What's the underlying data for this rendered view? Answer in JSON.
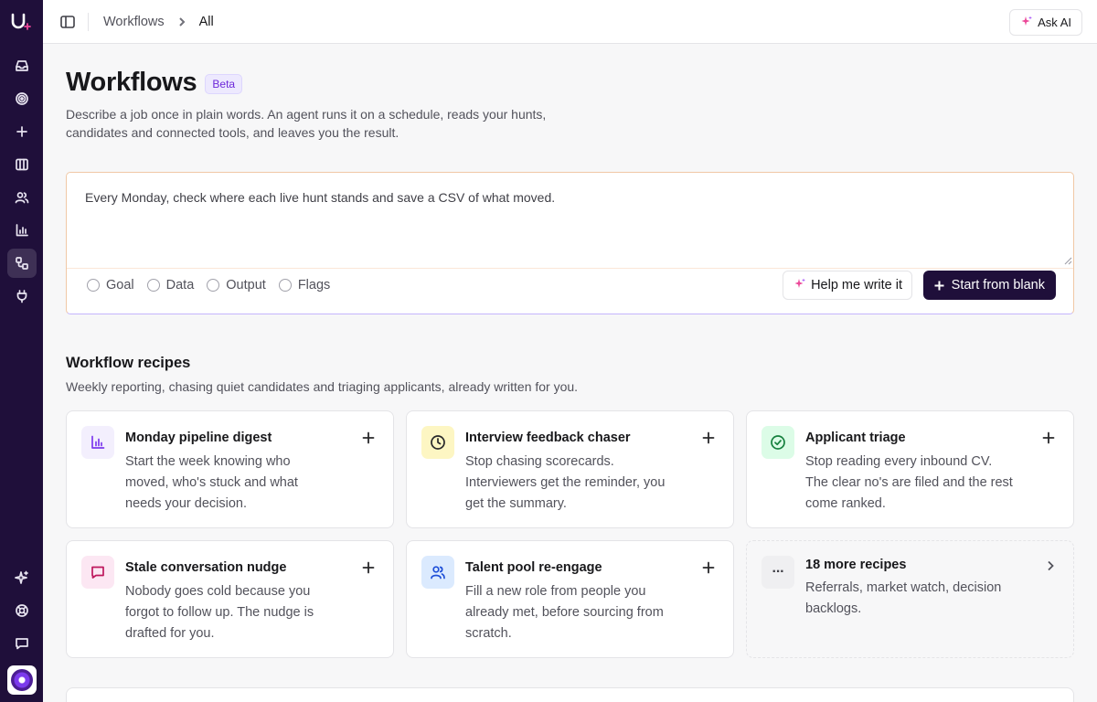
{
  "app": {
    "logo_text": "U"
  },
  "sidebar": {
    "items": [
      {
        "name": "inbox-icon"
      },
      {
        "name": "target-icon"
      },
      {
        "name": "plus-icon"
      },
      {
        "name": "columns-icon"
      },
      {
        "name": "users-icon"
      },
      {
        "name": "chart-icon"
      },
      {
        "name": "workflow-icon",
        "active": true
      },
      {
        "name": "plug-icon"
      }
    ],
    "bottom": [
      {
        "name": "sparkles-icon"
      },
      {
        "name": "help-icon"
      },
      {
        "name": "message-icon"
      }
    ]
  },
  "topbar": {
    "breadcrumb": [
      "Workflows",
      "All"
    ],
    "ask_ai": "Ask AI"
  },
  "header": {
    "title": "Workflows",
    "badge": "Beta",
    "subtitle": "Describe a job once in plain words. An agent runs it on a schedule, reads your hunts, candidates and connected tools, and leaves you the result."
  },
  "composer": {
    "value": "Every Monday, check where each live hunt stands and save a CSV of what moved.",
    "chips": [
      "Goal",
      "Data",
      "Output",
      "Flags"
    ],
    "help_label": "Help me write it",
    "blank_label": "Start from blank"
  },
  "recipes": {
    "title": "Workflow recipes",
    "subtitle": "Weekly reporting, chasing quiet candidates and triaging applicants, already written for you.",
    "cards": [
      {
        "title": "Monday pipeline digest",
        "desc": "Start the week knowing who moved, who's stuck and what needs your decision.",
        "icon": "bar-chart-icon",
        "color": "#7c3aed",
        "bg": "#f3effd"
      },
      {
        "title": "Interview feedback chaser",
        "desc": "Stop chasing scorecards. Interviewers get the reminder, you get the summary.",
        "icon": "clock-icon",
        "color": "#27272a",
        "bg": "#fdf6c3"
      },
      {
        "title": "Applicant triage",
        "desc": "Stop reading every inbound CV. The clear no's are filed and the rest come ranked.",
        "icon": "check-circle-icon",
        "color": "#15803d",
        "bg": "#dcfce7"
      },
      {
        "title": "Stale conversation nudge",
        "desc": "Nobody goes cold because you forgot to follow up. The nudge is drafted for you.",
        "icon": "chat-icon",
        "color": "#be185d",
        "bg": "#fce7f3"
      },
      {
        "title": "Talent pool re-engage",
        "desc": "Fill a new role from people you already met, before sourcing from scratch.",
        "icon": "people-icon",
        "color": "#1d4ed8",
        "bg": "#dbeafe"
      }
    ],
    "more": {
      "title": "18 more recipes",
      "desc": "Referrals, market watch, decision backlogs.",
      "icon_text": "···"
    }
  }
}
